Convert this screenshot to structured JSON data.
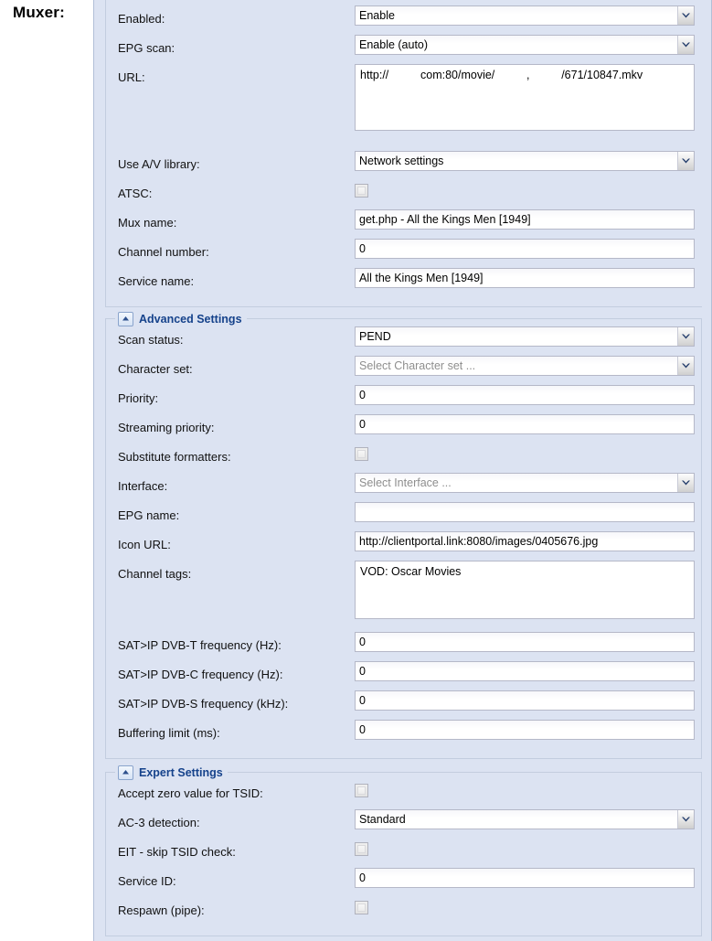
{
  "side_label": "Muxer:",
  "basic": {
    "rows": [
      {
        "label": "Enabled:",
        "type": "combo",
        "value": "Enable"
      },
      {
        "label": "EPG scan:",
        "type": "combo",
        "value": "Enable (auto)"
      },
      {
        "label": "URL:",
        "type": "textarea",
        "value": "http://          com:80/movie/          ,          /671/10847.mkv"
      },
      {
        "label": "Use A/V library:",
        "type": "combo",
        "value": "Network settings"
      },
      {
        "label": "ATSC:",
        "type": "checkbox",
        "value": ""
      },
      {
        "label": "Mux name:",
        "type": "text",
        "value": "get.php - All the Kings Men [1949]"
      },
      {
        "label": "Channel number:",
        "type": "text",
        "value": "0"
      },
      {
        "label": "Service name:",
        "type": "text",
        "value": "All the Kings Men [1949]"
      }
    ]
  },
  "advanced": {
    "legend": "Advanced Settings",
    "toggle_icon": "chevron-up-icon",
    "rows": [
      {
        "label": "Scan status:",
        "type": "combo",
        "value": "PEND"
      },
      {
        "label": "Character set:",
        "type": "combo",
        "value": "Select Character set ...",
        "placeholder": true
      },
      {
        "label": "Priority:",
        "type": "text",
        "value": "0"
      },
      {
        "label": "Streaming priority:",
        "type": "text",
        "value": "0"
      },
      {
        "label": "Substitute formatters:",
        "type": "checkbox",
        "value": ""
      },
      {
        "label": "Interface:",
        "type": "combo",
        "value": "Select Interface ...",
        "placeholder": true
      },
      {
        "label": "EPG name:",
        "type": "text",
        "value": ""
      },
      {
        "label": "Icon URL:",
        "type": "text",
        "value": "http://clientportal.link:8080/images/0405676.jpg"
      },
      {
        "label": "Channel tags:",
        "type": "textarea",
        "value": "VOD: Oscar Movies"
      },
      {
        "label": "SAT>IP DVB-T frequency (Hz):",
        "type": "text",
        "value": "0"
      },
      {
        "label": "SAT>IP DVB-C frequency (Hz):",
        "type": "text",
        "value": "0"
      },
      {
        "label": "SAT>IP DVB-S frequency (kHz):",
        "type": "text",
        "value": "0"
      },
      {
        "label": "Buffering limit (ms):",
        "type": "text",
        "value": "0"
      }
    ]
  },
  "expert": {
    "legend": "Expert Settings",
    "toggle_icon": "chevron-up-icon",
    "rows": [
      {
        "label": "Accept zero value for TSID:",
        "type": "checkbox",
        "value": ""
      },
      {
        "label": "AC-3 detection:",
        "type": "combo",
        "value": "Standard"
      },
      {
        "label": "EIT - skip TSID check:",
        "type": "checkbox",
        "value": ""
      },
      {
        "label": "Service ID:",
        "type": "text",
        "value": "0"
      },
      {
        "label": "Respawn (pipe):",
        "type": "checkbox",
        "value": ""
      }
    ]
  },
  "colors": {
    "panel_bg": "#dce3f2",
    "legend_text": "#15428b",
    "field_border": "#b5b8c8",
    "placeholder_text": "#8e8e8e"
  }
}
